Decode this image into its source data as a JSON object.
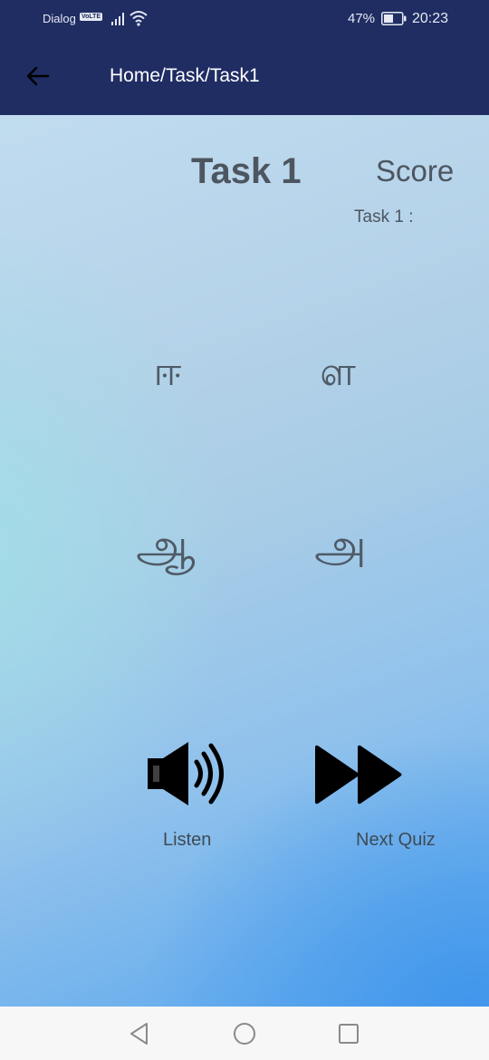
{
  "status_bar": {
    "carrier": "Dialog",
    "volte": "VoLTE",
    "battery_percent": "47%",
    "time": "20:23",
    "icons": [
      "signal-icon",
      "wifi-icon",
      "battery-icon"
    ]
  },
  "app_bar": {
    "back_icon": "arrow-left-icon",
    "breadcrumb": "Home/Task/Task1"
  },
  "main": {
    "task_title": "Task 1",
    "score_title": "Score",
    "score_line": "Task 1 :",
    "letters": [
      "ஈ",
      "ள",
      "ஆ",
      "அ"
    ],
    "listen_icon": "speaker-icon",
    "listen_label": "Listen",
    "next_icon": "fast-forward-icon",
    "next_label": "Next Quiz"
  },
  "nav_bar": {
    "icons": [
      "nav-back-icon",
      "nav-home-icon",
      "nav-recent-icon"
    ]
  },
  "colors": {
    "app_bar": "#1f2d63",
    "text": "#4d5660",
    "nav_bar": "#f7f7f7"
  }
}
